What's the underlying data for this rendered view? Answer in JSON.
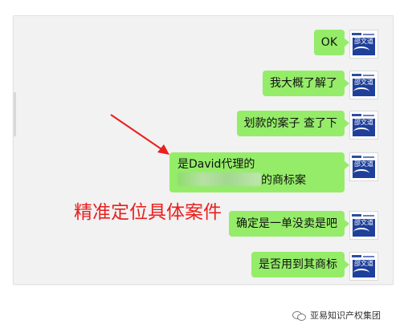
{
  "chat": {
    "messages": [
      {
        "text": "OK"
      },
      {
        "text": "我大概了解了"
      },
      {
        "text": "划款的案子 查了下"
      },
      {
        "text_prefix": "是David代理的",
        "text_suffix": "的商标案"
      },
      {
        "text": "确定是一单没卖是吧"
      },
      {
        "text": "是否用到其商标"
      }
    ],
    "avatar_label": "邵文道"
  },
  "annotation": {
    "text": "精准定位具体案件",
    "color": "#e8201f"
  },
  "footer": {
    "text": "亚易知识产权集团"
  },
  "colors": {
    "bubble": "#95ec69",
    "panel": "#f2f2f2"
  },
  "icons": [
    "wechat-icon",
    "avatar",
    "red-arrow"
  ]
}
